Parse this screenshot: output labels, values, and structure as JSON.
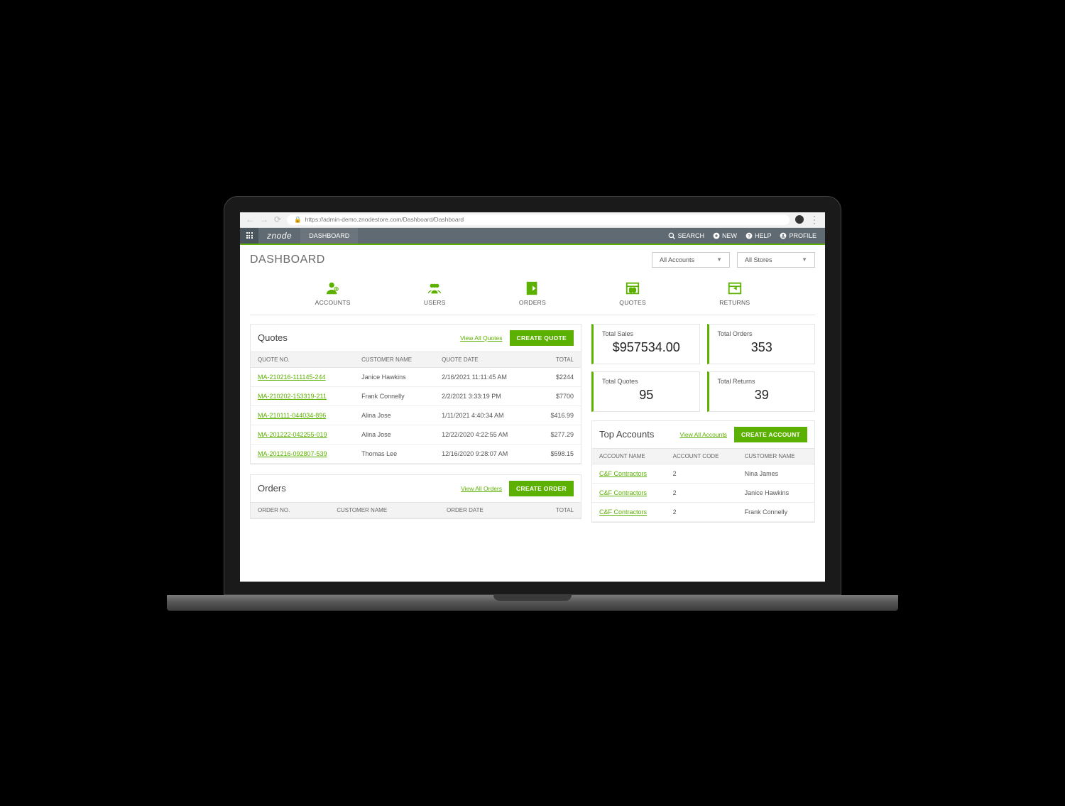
{
  "browser": {
    "url": "https://admin-demo.znodestore.com/Dashboard/Dashboard"
  },
  "topbar": {
    "logo": "znode",
    "breadcrumb": "DASHBOARD",
    "search": "SEARCH",
    "new": "NEW",
    "help": "HELP",
    "profile": "PROFILE"
  },
  "page_title": "DASHBOARD",
  "filters": {
    "accounts": "All Accounts",
    "stores": "All Stores"
  },
  "tabs": {
    "accounts": "ACCOUNTS",
    "users": "USERS",
    "orders": "ORDERS",
    "quotes": "QUOTES",
    "returns": "RETURNS"
  },
  "quotes": {
    "title": "Quotes",
    "view_all": "View All Quotes",
    "create": "CREATE QUOTE",
    "headers": {
      "no": "QUOTE NO.",
      "customer": "CUSTOMER NAME",
      "date": "QUOTE DATE",
      "total": "TOTAL"
    },
    "rows": [
      {
        "no": "MA-210216-111145-244",
        "customer": "Janice Hawkins",
        "date": "2/16/2021 11:11:45 AM",
        "total": "$2244"
      },
      {
        "no": "MA-210202-153319-211",
        "customer": "Frank Connelly",
        "date": "2/2/2021 3:33:19 PM",
        "total": "$7700"
      },
      {
        "no": "MA-210111-044034-896",
        "customer": "Alina Jose",
        "date": "1/11/2021 4:40:34 AM",
        "total": "$416.99"
      },
      {
        "no": "MA-201222-042255-019",
        "customer": "Alina Jose",
        "date": "12/22/2020 4:22:55 AM",
        "total": "$277.29"
      },
      {
        "no": "MA-201216-092807-539",
        "customer": "Thomas Lee",
        "date": "12/16/2020 9:28:07 AM",
        "total": "$598.15"
      }
    ]
  },
  "orders": {
    "title": "Orders",
    "view_all": "View All Orders",
    "create": "CREATE ORDER",
    "headers": {
      "no": "ORDER NO.",
      "customer": "CUSTOMER NAME",
      "date": "ORDER DATE",
      "total": "TOTAL"
    }
  },
  "stats": {
    "total_sales": {
      "label": "Total Sales",
      "value": "$957534.00"
    },
    "total_orders": {
      "label": "Total Orders",
      "value": "353"
    },
    "total_quotes": {
      "label": "Total Quotes",
      "value": "95"
    },
    "total_returns": {
      "label": "Total Returns",
      "value": "39"
    }
  },
  "top_accounts": {
    "title": "Top Accounts",
    "view_all": "View All Accounts",
    "create": "CREATE ACCOUNT",
    "headers": {
      "name": "ACCOUNT NAME",
      "code": "ACCOUNT CODE",
      "customer": "CUSTOMER NAME"
    },
    "rows": [
      {
        "name": "C&F Contractors",
        "code": "2",
        "customer": "Nina James"
      },
      {
        "name": "C&F Contractors",
        "code": "2",
        "customer": "Janice Hawkins"
      },
      {
        "name": "C&F Contractors",
        "code": "2",
        "customer": "Frank Connelly"
      }
    ]
  }
}
